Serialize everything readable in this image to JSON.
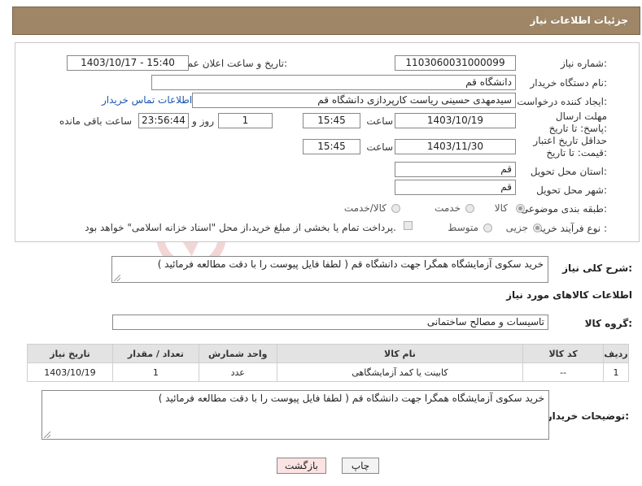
{
  "header": {
    "title": "جزئیات اطلاعات نیاز"
  },
  "watermark": "AriaTender.net",
  "form": {
    "need_number_label": "شماره نیاز:",
    "need_number": "1103060031000099",
    "announce_label": "تاریخ و ساعت اعلان عمومی:",
    "announce_value": "1403/10/17 - 15:40",
    "buyer_org_label": "نام دستگاه خریدار:",
    "buyer_org": "دانشگاه قم",
    "requester_label": "ایجاد کننده درخواست:",
    "requester": "سیدمهدی حسینی ریاست کارپردازی دانشگاه قم",
    "contact_link": "اطلاعات تماس خریدار",
    "reply_deadline_label": "مهلت ارسال پاسخ: تا تاریخ:",
    "reply_date": "1403/10/19",
    "time_label": "ساعت",
    "reply_time": "15:45",
    "days_value": "1",
    "days_label": "روز و",
    "remaining_time": "23:56:44",
    "remaining_label": "ساعت باقی مانده",
    "price_validity_label": "حداقل تاریخ اعتبار قیمت: تا تاریخ:",
    "validity_date": "1403/11/30",
    "validity_time": "15:45",
    "province_label": "استان محل تحویل:",
    "province": "قم",
    "city_label": "شهر محل تحویل:",
    "city": "قم",
    "category_label": "طبقه بندی موضوعی:",
    "category_options": [
      "کالا",
      "خدمت",
      "کالا/خدمت"
    ],
    "process_label": "نوع فرآیند خرید :",
    "process_options": [
      "جزیی",
      "متوسط"
    ],
    "payment_note": "پرداخت تمام یا بخشی از مبلغ خرید،از محل \"اسناد خزانه اسلامی\" خواهد بود."
  },
  "summary": {
    "label": "شرح کلی نیاز:",
    "text": "خرید سکوی آزمایشگاه همگرا جهت دانشگاه قم ( لطفا فایل پیوست را با دقت مطالعه فرمائید )"
  },
  "goods_section_title": "اطلاعات کالاهای مورد نیاز",
  "goods_group": {
    "label": "گروه کالا:",
    "value": "تاسیسات و مصالح ساختمانی"
  },
  "table": {
    "headers": [
      "ردیف",
      "کد کالا",
      "نام کالا",
      "واحد شمارش",
      "تعداد / مقدار",
      "تاریخ نیاز"
    ],
    "rows": [
      {
        "index": "1",
        "code": "--",
        "name": "کابینت یا کمد آزمایشگاهی",
        "unit": "عدد",
        "qty": "1",
        "date": "1403/10/19"
      }
    ]
  },
  "buyer_notes": {
    "label": "توضیحات خریدار:",
    "text": "خرید سکوی آزمایشگاه همگرا جهت دانشگاه قم ( لطفا فایل پیوست را با دقت مطالعه فرمائید )"
  },
  "buttons": {
    "print": "چاپ",
    "back": "بازگشت"
  },
  "colors": {
    "title_bg": "#9e8666",
    "back_btn_bg": "#fbe3e3",
    "link": "#1a56b0",
    "table_header_bg": "#e3e3e3"
  }
}
